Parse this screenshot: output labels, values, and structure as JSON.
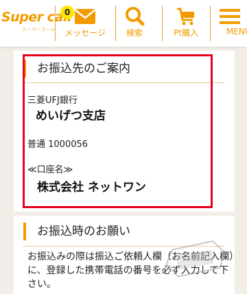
{
  "header": {
    "logo_text": "Super call",
    "logo_sub": "スーパーコール",
    "nav": {
      "messages": {
        "label": "メッセージ",
        "badge": "0"
      },
      "search": {
        "label": "検索"
      },
      "pt_purchase": {
        "label": "Pt購入"
      },
      "menu": {
        "label": "MENU"
      }
    }
  },
  "bank_info": {
    "heading": "お振込先のご案内",
    "bank_name": "三菱UFJ銀行",
    "branch_name": "めいげつ支店",
    "account_number": "普通 1000056",
    "account_name_label": "≪口座名≫",
    "account_name": "株式会社 ネットワン"
  },
  "request": {
    "heading": "お振込時のお願い",
    "body_lines": [
      "お振込みの際は振込ご依頼人欄（お名前記入欄）",
      "に、登録した携帯電話の番号を必ず入力して下",
      "さい。"
    ]
  },
  "colors": {
    "accent": "#f29b00",
    "highlight_frame": "#e8001c",
    "badge": "#ffe600",
    "background": "#f2ede6"
  }
}
